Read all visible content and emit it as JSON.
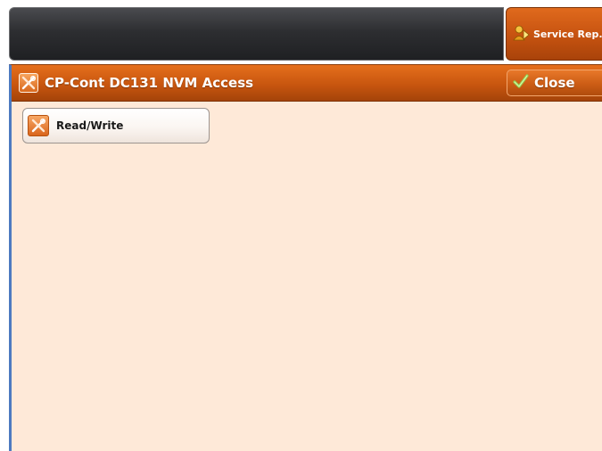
{
  "header": {
    "service_tab_label": "Service Rep.",
    "service_icon": "service-rep-icon"
  },
  "window": {
    "title": "CP-Cont DC131 NVM Access",
    "title_icon": "tools-icon",
    "close_label": "Close",
    "close_icon": "checkmark-icon"
  },
  "content": {
    "buttons": [
      {
        "label": "Read/Write",
        "icon": "tools-icon"
      }
    ]
  },
  "colors": {
    "accent_orange": "#c85411",
    "content_bg": "#fee9d8",
    "topbar_dark": "#2d2e31",
    "left_border_blue": "#4d7ac0"
  }
}
